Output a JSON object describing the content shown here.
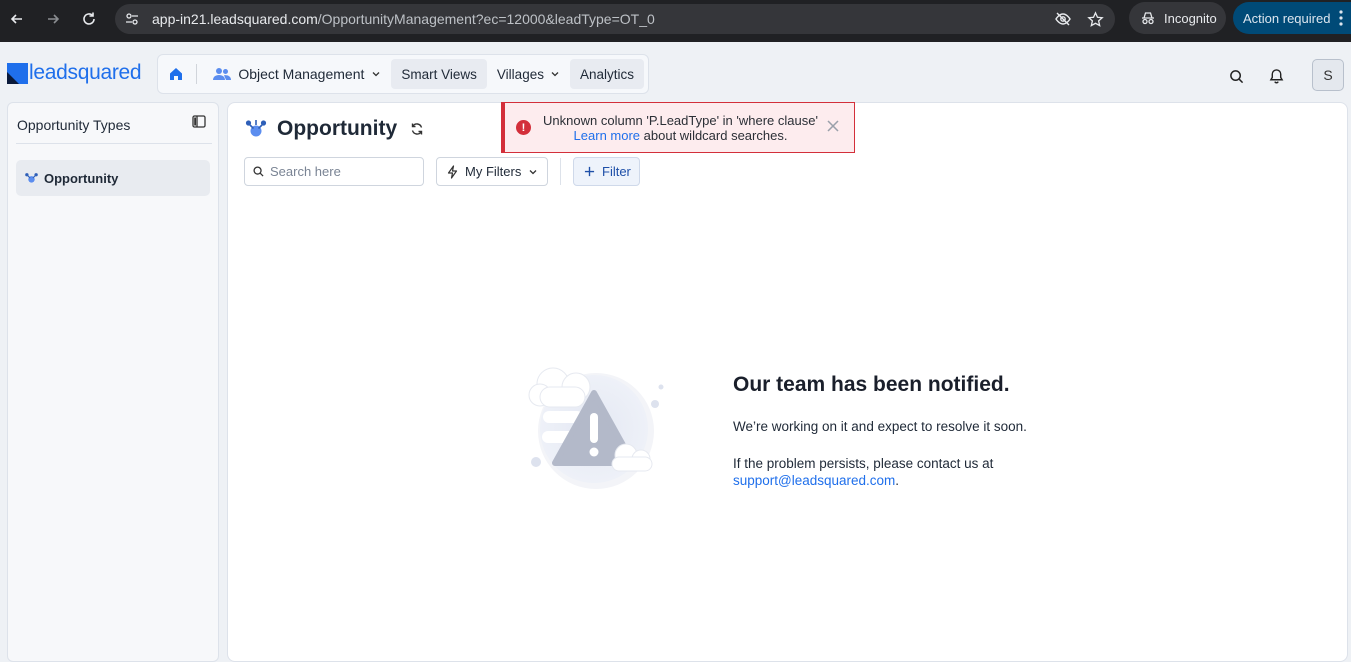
{
  "browser": {
    "url_host": "app-in21.leadsquared.com",
    "url_path": "/OpportunityManagement?ec=12000&leadType=OT_0",
    "incognito_label": "Incognito",
    "action_required_label": "Action required"
  },
  "header": {
    "logo_text": "leadsquared",
    "nav": {
      "object_management": "Object Management",
      "smart_views": "Smart Views",
      "villages": "Villages",
      "analytics": "Analytics"
    },
    "avatar_initial": "S"
  },
  "sidebar": {
    "title": "Opportunity Types",
    "items": [
      {
        "label": "Opportunity"
      }
    ]
  },
  "main": {
    "title": "Opportunity",
    "search_placeholder": "Search here",
    "my_filters_label": "My Filters",
    "filter_label": "Filter"
  },
  "error_state": {
    "title": "Our team has been notified.",
    "line1": "We’re working on it and expect to resolve it soon.",
    "line2": "If the problem persists, please contact us at",
    "email": "support@leadsquared.com",
    "email_suffix": "."
  },
  "toast": {
    "message": "Unknown column 'P.LeadType' in 'where clause'",
    "link_text": "Learn more",
    "link_suffix": " about wildcard searches."
  },
  "colors": {
    "brand_blue": "#1f6feb",
    "error_red": "#d32f3a",
    "action_required_bg": "#004a77"
  }
}
